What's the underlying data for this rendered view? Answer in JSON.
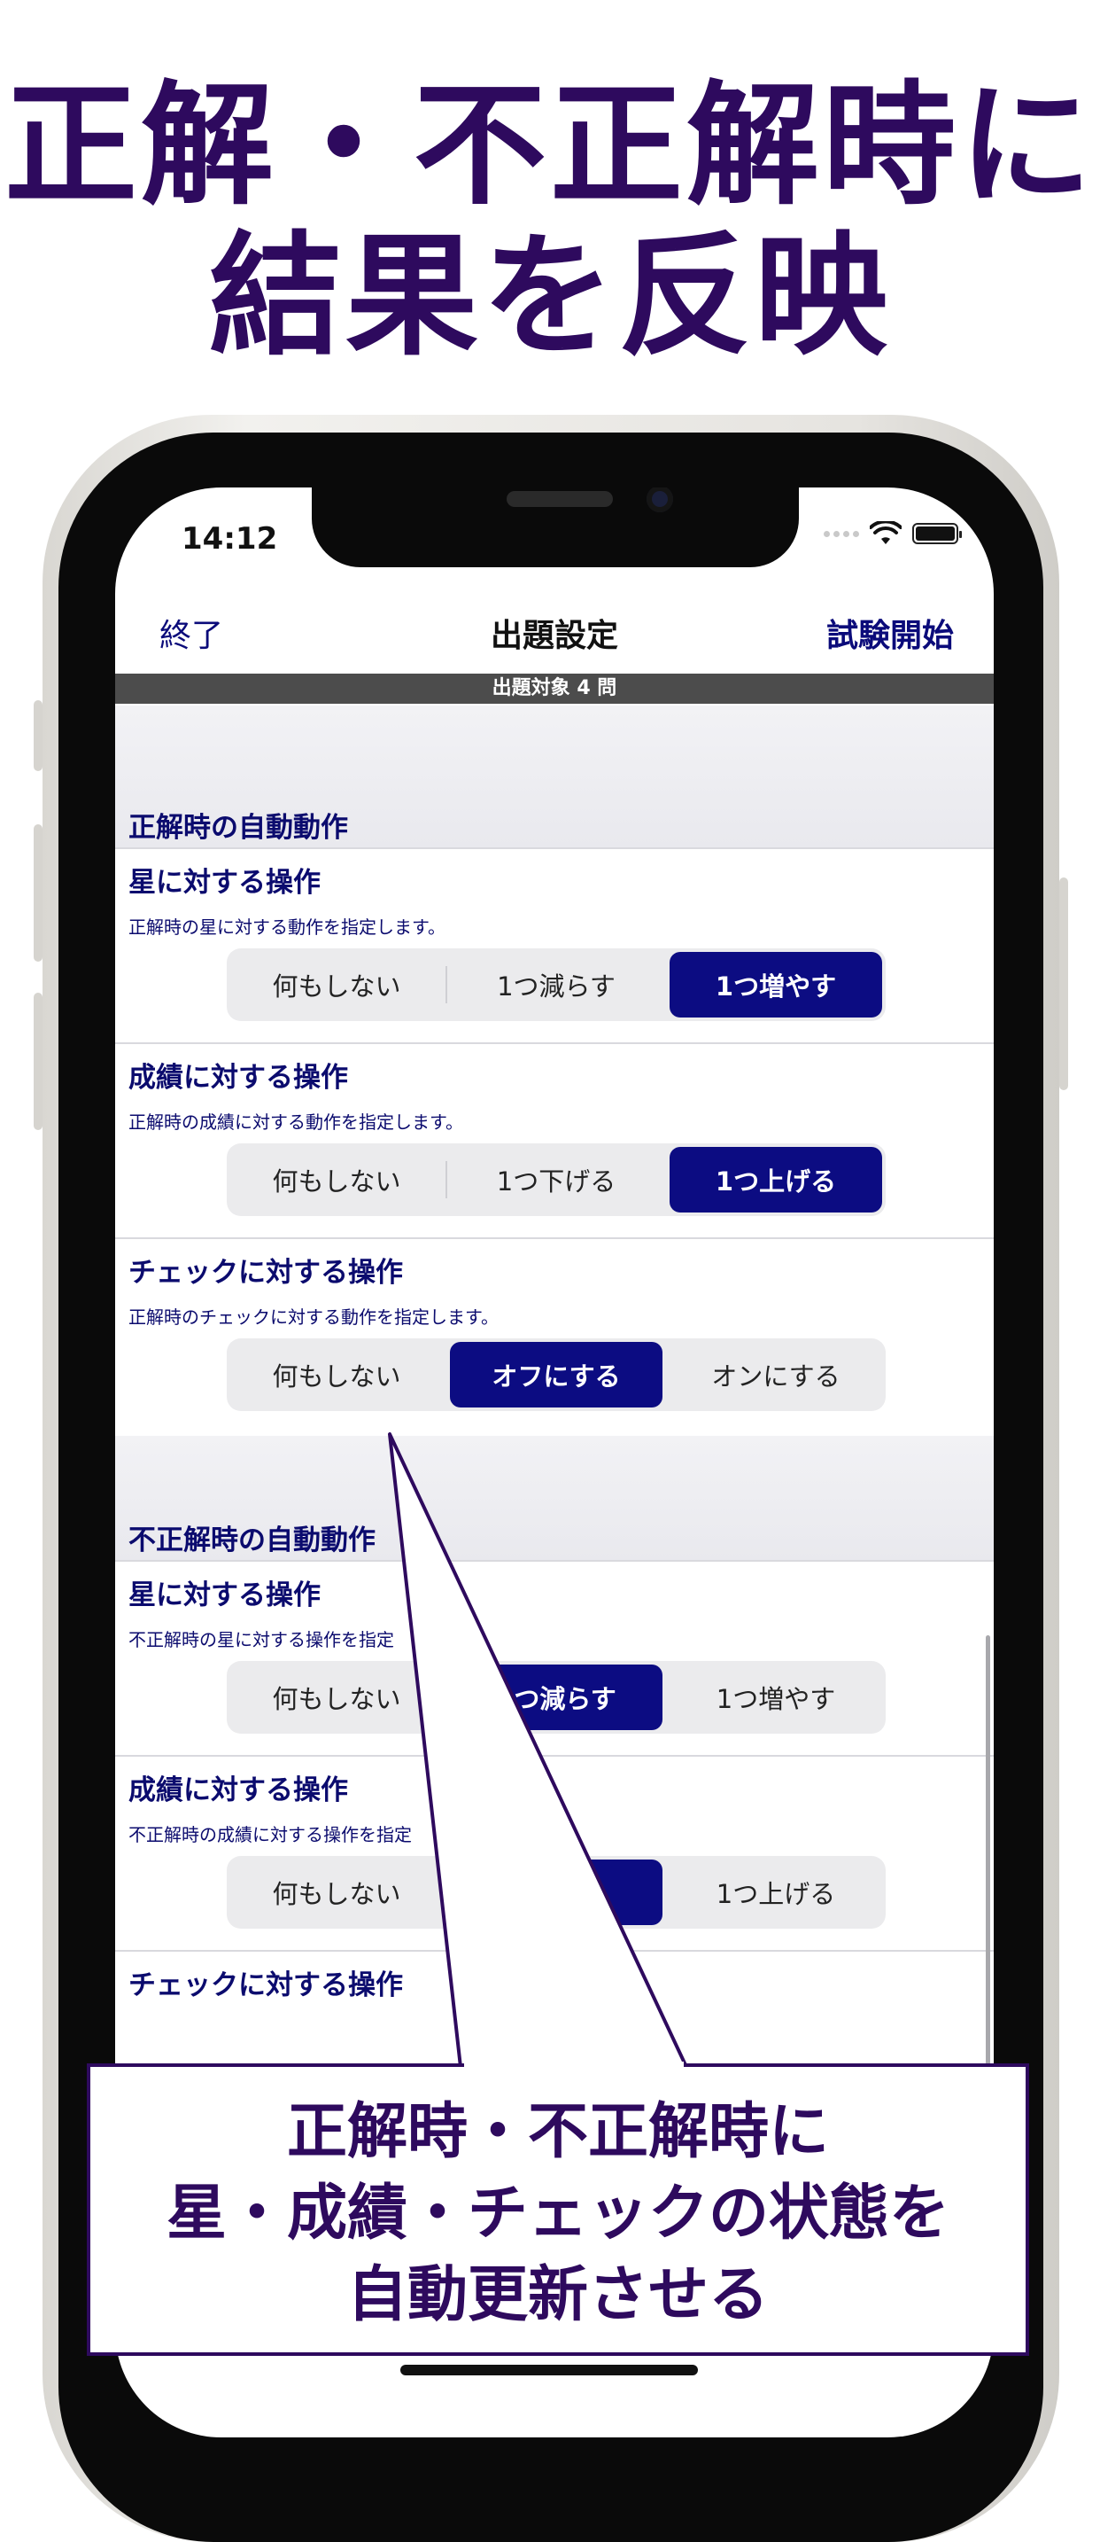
{
  "headline": {
    "line1": "正解・不正解時に",
    "line2": "結果を反映"
  },
  "status_bar": {
    "time": "14:12"
  },
  "nav": {
    "left": "終了",
    "title": "出題設定",
    "right": "試験開始"
  },
  "subbar": "出題対象 4 問",
  "sections": [
    {
      "title": "正解時の自動動作",
      "rows": [
        {
          "title": "星に対する操作",
          "desc": "正解時の星に対する動作を指定します。",
          "options": [
            "何もしない",
            "1つ減らす",
            "1つ増やす"
          ],
          "selected": 2
        },
        {
          "title": "成績に対する操作",
          "desc": "正解時の成績に対する動作を指定します。",
          "options": [
            "何もしない",
            "1つ下げる",
            "1つ上げる"
          ],
          "selected": 2
        },
        {
          "title": "チェックに対する操作",
          "desc": "正解時のチェックに対する動作を指定します。",
          "options": [
            "何もしない",
            "オフにする",
            "オンにする"
          ],
          "selected": 1
        }
      ]
    },
    {
      "title": "不正解時の自動動作",
      "rows": [
        {
          "title": "星に対する操作",
          "desc": "不正解時の星に対する操作を指定",
          "options": [
            "何もしない",
            "1つ減らす",
            "1つ増やす"
          ],
          "selected": 1
        },
        {
          "title": "成績に対する操作",
          "desc": "不正解時の成績に対する操作を指定",
          "options": [
            "何もしない",
            "",
            "1つ上げる"
          ],
          "selected": 1
        },
        {
          "title": "チェックに対する操作",
          "desc": "",
          "options": [],
          "selected": -1
        }
      ]
    }
  ],
  "callout": {
    "line1": "正解時・不正解時に",
    "line2": "星・成績・チェックの状態を",
    "line3": "自動更新させる"
  },
  "colors": {
    "headline": "#2e0a5e",
    "accent": "#0c0c82",
    "label": "#0b0b6e"
  }
}
